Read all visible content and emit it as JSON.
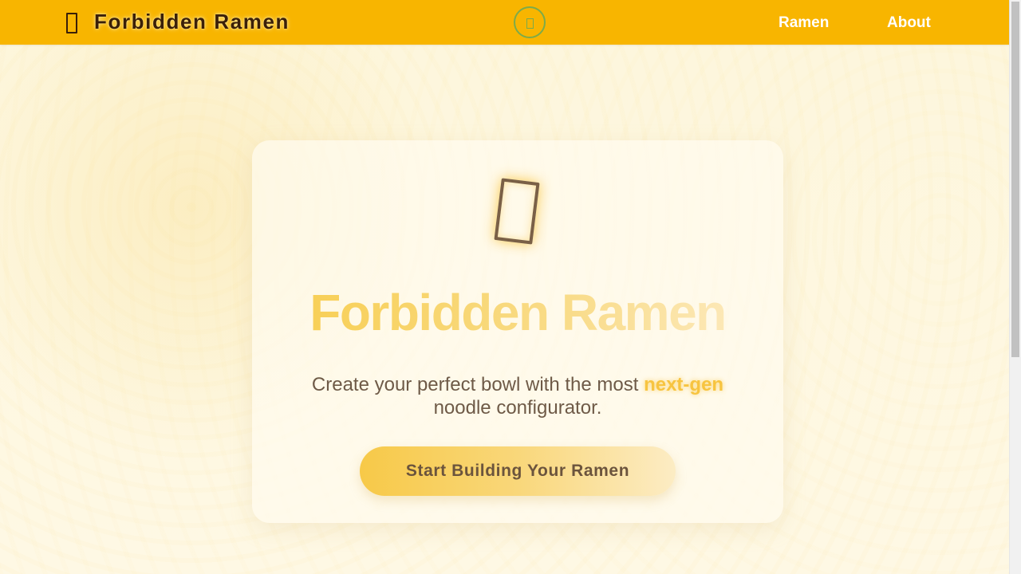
{
  "header": {
    "brand_icon": "noodle-box-icon",
    "brand_title": "Forbidden Ramen",
    "toggle_icon": "theme-toggle-icon",
    "nav": [
      {
        "label": "Ramen"
      },
      {
        "label": "About"
      }
    ],
    "bg_color": "#f8b500"
  },
  "hero": {
    "icon": "bowl-frame-icon",
    "title": "Forbidden Ramen",
    "subtitle_before": "Create your perfect bowl with the most ",
    "subtitle_highlight": "next-gen",
    "subtitle_after": " noodle configurator.",
    "cta_label": "Start Building Your Ramen",
    "accent_color": "#f7c440"
  }
}
